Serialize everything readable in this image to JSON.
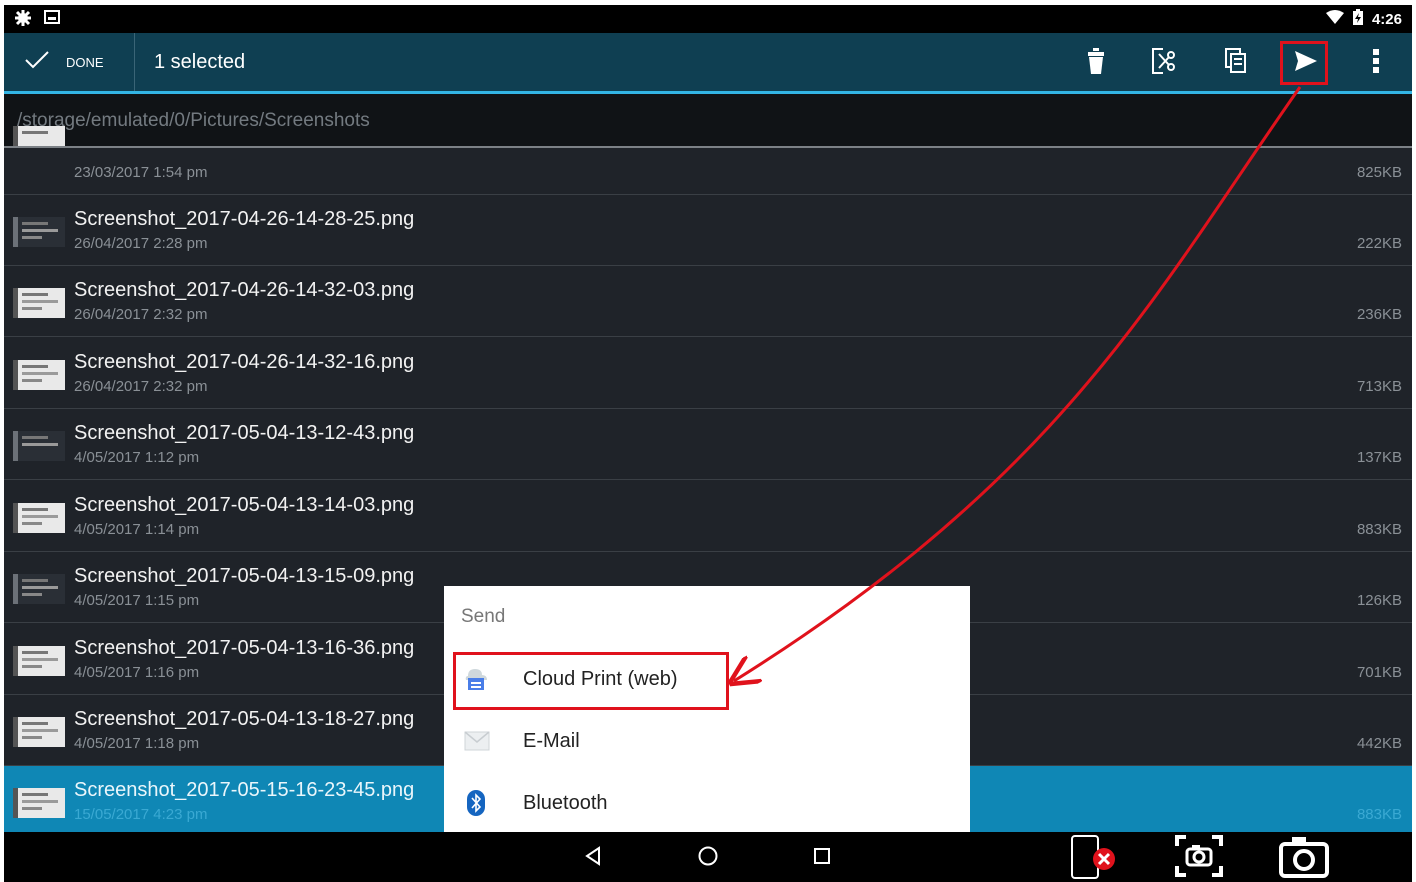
{
  "status_bar": {
    "time": "4:26"
  },
  "action_bar": {
    "done_label": "DONE",
    "selected_label": "1 selected",
    "icons": [
      "delete-icon",
      "cut-icon",
      "copy-icon",
      "send-icon",
      "overflow-menu-icon"
    ]
  },
  "path": "/storage/emulated/0/Pictures/Screenshots",
  "files": [
    {
      "name": "",
      "date": "23/03/2017 1:54 pm",
      "size": "825KB",
      "selected": false
    },
    {
      "name": "Screenshot_2017-04-26-14-28-25.png",
      "date": "26/04/2017 2:28 pm",
      "size": "222KB",
      "selected": false
    },
    {
      "name": "Screenshot_2017-04-26-14-32-03.png",
      "date": "26/04/2017 2:32 pm",
      "size": "236KB",
      "selected": false
    },
    {
      "name": "Screenshot_2017-04-26-14-32-16.png",
      "date": "26/04/2017 2:32 pm",
      "size": "713KB",
      "selected": false
    },
    {
      "name": "Screenshot_2017-05-04-13-12-43.png",
      "date": "4/05/2017 1:12 pm",
      "size": "137KB",
      "selected": false
    },
    {
      "name": "Screenshot_2017-05-04-13-14-03.png",
      "date": "4/05/2017 1:14 pm",
      "size": "883KB",
      "selected": false
    },
    {
      "name": "Screenshot_2017-05-04-13-15-09.png",
      "date": "4/05/2017 1:15 pm",
      "size": "126KB",
      "selected": false
    },
    {
      "name": "Screenshot_2017-05-04-13-16-36.png",
      "date": "4/05/2017 1:16 pm",
      "size": "701KB",
      "selected": false
    },
    {
      "name": "Screenshot_2017-05-04-13-18-27.png",
      "date": "4/05/2017 1:18 pm",
      "size": "442KB",
      "selected": false
    },
    {
      "name": "Screenshot_2017-05-15-16-23-45.png",
      "date": "15/05/2017 4:23 pm",
      "size": "883KB",
      "selected": true
    }
  ],
  "send_dialog": {
    "title": "Send",
    "options": [
      {
        "label": "Cloud Print (web)",
        "icon": "cloud-print-icon"
      },
      {
        "label": "E-Mail",
        "icon": "email-icon"
      },
      {
        "label": "Bluetooth",
        "icon": "bluetooth-icon"
      }
    ]
  },
  "colors": {
    "action_bar": "#0f3f52",
    "accent": "#33b5e5",
    "list_background": "#1f2329",
    "selected_row": "#0f87b5",
    "annotation": "#e0121c"
  }
}
